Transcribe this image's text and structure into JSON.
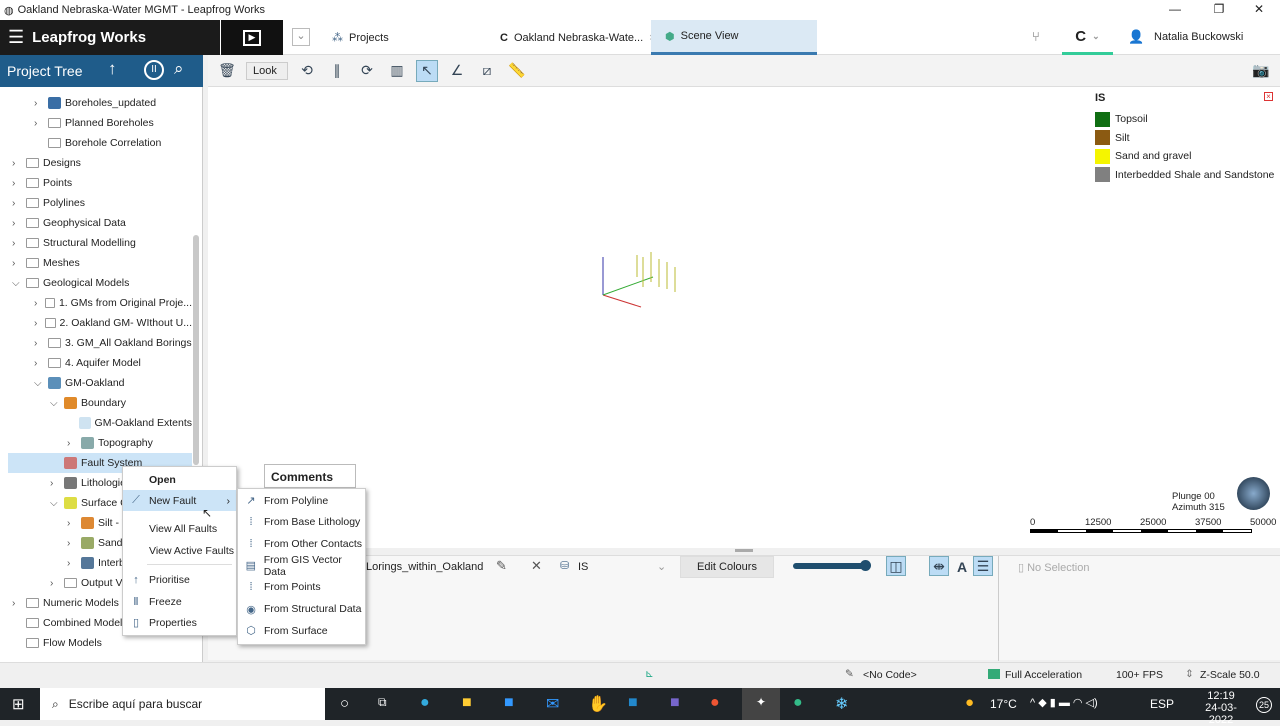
{
  "window": {
    "title": "Oakland Nebraska-Water MGMT - Leapfrog Works",
    "minimize": "—",
    "maximize": "❐",
    "close": "✕"
  },
  "app": {
    "brand": "Leapfrog Works",
    "tabs": [
      {
        "label": "Projects"
      },
      {
        "label": "Oakland Nebraska-Wate..."
      },
      {
        "label": "Scene View"
      }
    ],
    "user": "Natalia Buckowski",
    "accent": "#1f5c8a"
  },
  "tree_header": {
    "title": "Project Tree"
  },
  "toolbar": {
    "look": "Look"
  },
  "tree": [
    {
      "label": "Boreholes_updated",
      "level": 1,
      "arrow": true,
      "icon": "boreholes"
    },
    {
      "label": "Planned Boreholes",
      "level": 1,
      "arrow": true,
      "icon": "folder"
    },
    {
      "label": "Borehole Correlation",
      "level": 1,
      "arrow": false,
      "icon": "folder"
    },
    {
      "label": "Designs",
      "level": 0,
      "arrow": true,
      "icon": "folder"
    },
    {
      "label": "Points",
      "level": 0,
      "arrow": true,
      "icon": "folder"
    },
    {
      "label": "Polylines",
      "level": 0,
      "arrow": true,
      "icon": "folder"
    },
    {
      "label": "Geophysical Data",
      "level": 0,
      "arrow": true,
      "icon": "folder"
    },
    {
      "label": "Structural Modelling",
      "level": 0,
      "arrow": true,
      "icon": "folder"
    },
    {
      "label": "Meshes",
      "level": 0,
      "arrow": true,
      "icon": "folder"
    },
    {
      "label": "Geological Models",
      "level": 0,
      "arrow": "open",
      "icon": "folder"
    },
    {
      "label": "1. GMs from Original Proje...",
      "level": 1,
      "arrow": true,
      "icon": "folder"
    },
    {
      "label": "2. Oakland GM- WIthout U...",
      "level": 1,
      "arrow": true,
      "icon": "folder"
    },
    {
      "label": "3. GM_All Oakland Borings",
      "level": 1,
      "arrow": true,
      "icon": "folder"
    },
    {
      "label": "4. Aquifer Model",
      "level": 1,
      "arrow": true,
      "icon": "folder"
    },
    {
      "label": "GM-Oakland",
      "level": 1,
      "arrow": "open",
      "icon": "model"
    },
    {
      "label": "Boundary",
      "level": 2,
      "arrow": "open",
      "icon": "boundary"
    },
    {
      "label": "GM-Oakland Extents",
      "level": 3,
      "arrow": false,
      "icon": "extents"
    },
    {
      "label": "Topography",
      "level": 3,
      "arrow": true,
      "icon": "topo"
    },
    {
      "label": "Fault System",
      "level": 2,
      "arrow": false,
      "icon": "fault",
      "selected": true
    },
    {
      "label": "Lithologie",
      "level": 2,
      "arrow": true,
      "icon": "litho"
    },
    {
      "label": "Surface C",
      "level": 2,
      "arrow": "open",
      "icon": "surface"
    },
    {
      "label": "Silt - T",
      "level": 3,
      "arrow": true,
      "icon": "silt"
    },
    {
      "label": "Sand a",
      "level": 3,
      "arrow": true,
      "icon": "sand"
    },
    {
      "label": "Interb",
      "level": 3,
      "arrow": true,
      "icon": "interb"
    },
    {
      "label": "Output Vo",
      "level": 2,
      "arrow": true,
      "icon": "folder"
    },
    {
      "label": "Numeric Models",
      "level": 0,
      "arrow": true,
      "icon": "folder"
    },
    {
      "label": "Combined Model",
      "level": 0,
      "arrow": false,
      "icon": "folder"
    },
    {
      "label": "Flow Models",
      "level": 0,
      "arrow": false,
      "icon": "folder"
    }
  ],
  "context_menu": {
    "items": [
      {
        "label": "Open"
      },
      {
        "label": "New Fault",
        "icon": "new-fault"
      },
      {
        "label": "View All Faults"
      },
      {
        "label": "View Active Faults"
      },
      {
        "label": "Prioritise",
        "icon": "↑"
      },
      {
        "label": "Freeze",
        "icon": "Ⅱ"
      },
      {
        "label": "Properties",
        "icon": "▯"
      }
    ]
  },
  "submenu": {
    "items": [
      {
        "label": "From Polyline"
      },
      {
        "label": "From Base Lithology"
      },
      {
        "label": "From Other Contacts"
      },
      {
        "label": "From GIS Vector Data"
      },
      {
        "label": "From Points"
      },
      {
        "label": "From Structural Data"
      },
      {
        "label": "From Surface"
      }
    ]
  },
  "comments": {
    "title": "Comments"
  },
  "legend": {
    "title": "IS",
    "items": [
      {
        "label": "Topsoil",
        "color": "#0f6e12"
      },
      {
        "label": "Silt",
        "color": "#8b5a12"
      },
      {
        "label": "Sand and gravel",
        "color": "#f5f500"
      },
      {
        "label": "Interbedded Shale and Sandstone",
        "color": "#808080"
      }
    ]
  },
  "scene": {
    "plunge": "Plunge 00",
    "azimuth": "Azimuth 315",
    "scale_ticks": [
      "0",
      "12500",
      "25000",
      "37500",
      "50000"
    ]
  },
  "bottom_panel": {
    "object": "Lorings_within_Oakland",
    "column": "IS",
    "edit_colours": "Edit Colours",
    "no_selection": "No Selection"
  },
  "status": {
    "code": "<No Code>",
    "acceleration": "Full Acceleration",
    "fps": "100+ FPS",
    "zscale": "Z-Scale 50.0"
  },
  "taskbar": {
    "search": "Escribe aquí para buscar",
    "temp": "17°C",
    "lang": "ESP",
    "time": "12:19",
    "date": "24-03-2022",
    "notif": "25"
  }
}
